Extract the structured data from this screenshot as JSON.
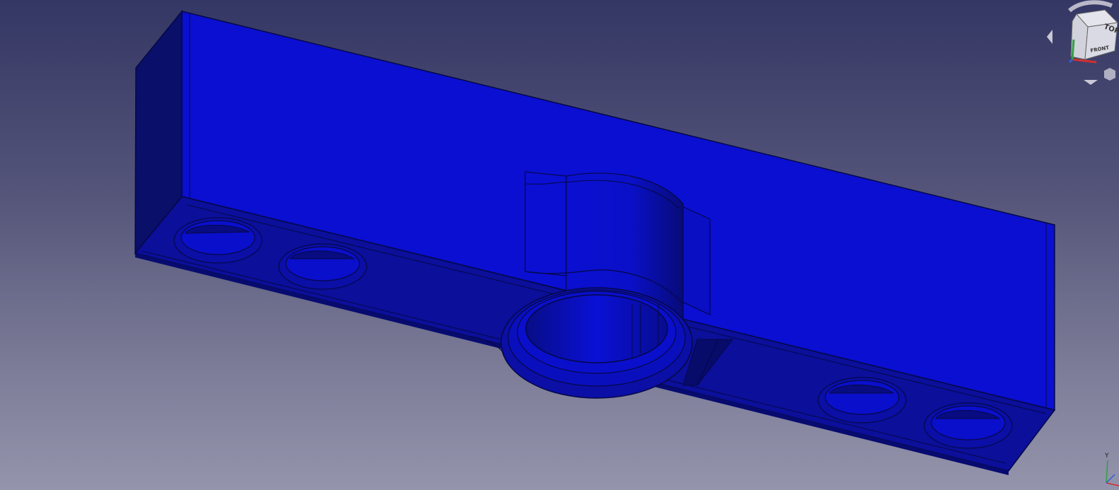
{
  "viewport": {
    "background_top": "#343764",
    "background_bottom": "#9494ac"
  },
  "model": {
    "face_color": "#0a0fd2",
    "shadow_color": "#0b0f9a",
    "dark_color": "#0a0f6a",
    "edge_color": "#050846"
  },
  "navcube": {
    "top_label": "TOP",
    "front_label": "FRONT",
    "icon": "view-cube-icon"
  },
  "axis_indicator": {
    "y_label": "Y",
    "icon": "axis-triad-icon"
  }
}
